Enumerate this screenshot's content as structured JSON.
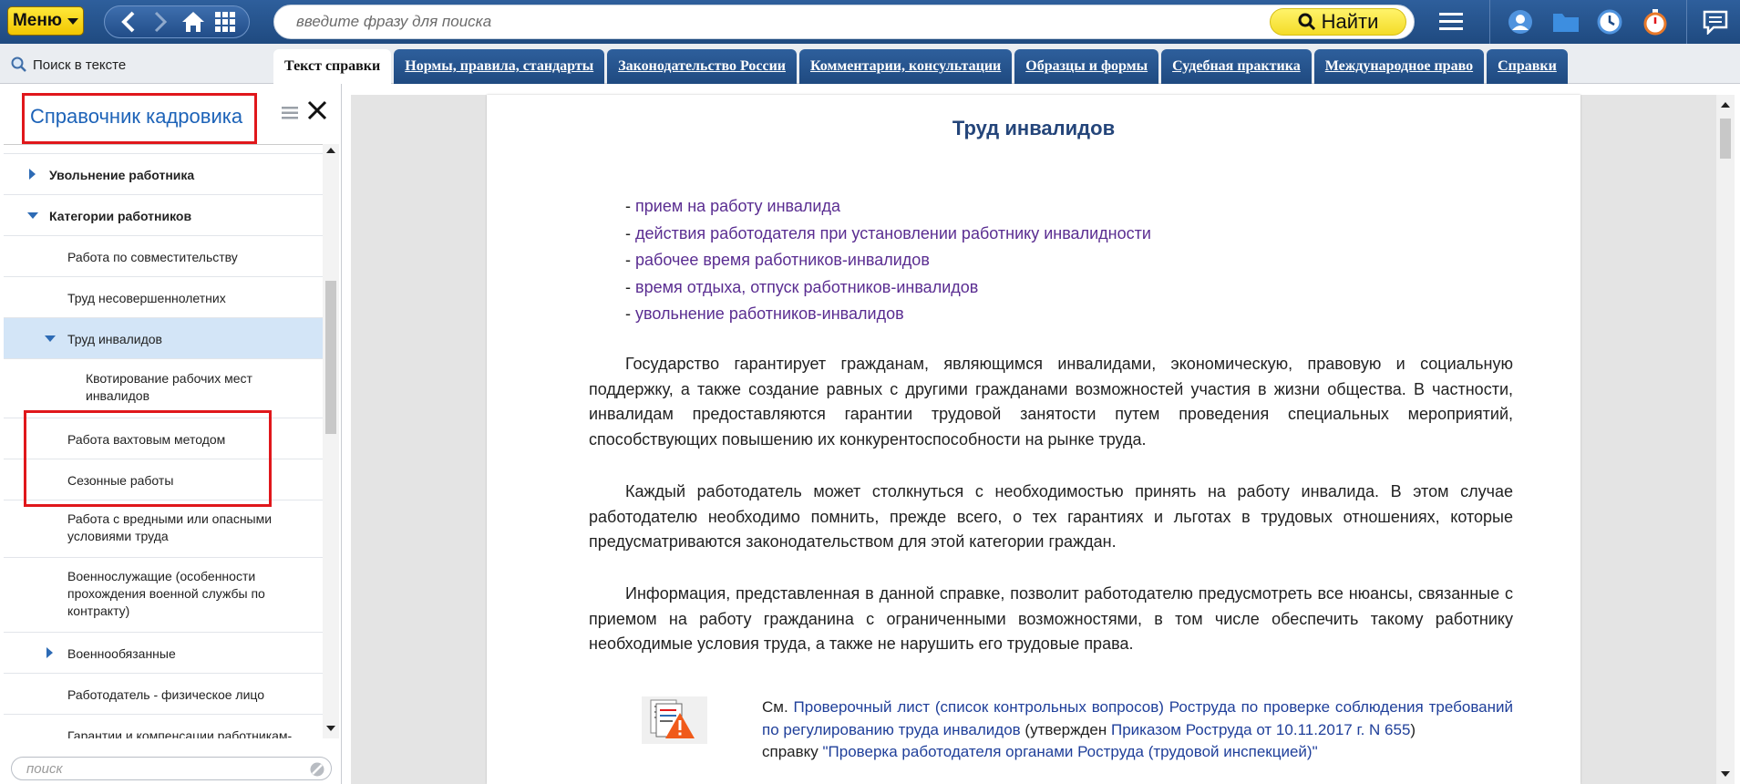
{
  "topbar": {
    "menu_label": "Меню",
    "search_placeholder": "введите фразу для поиска",
    "find_label": "Найти"
  },
  "tabsrow": {
    "search_in_text": "Поиск в тексте",
    "tabs": [
      {
        "label": "Текст справки",
        "active": true
      },
      {
        "label": "Нормы, правила, стандарты"
      },
      {
        "label": "Законодательство России"
      },
      {
        "label": "Комментарии, консультации"
      },
      {
        "label": "Образцы и формы"
      },
      {
        "label": "Судебная практика"
      },
      {
        "label": "Международное право"
      },
      {
        "label": "Справки"
      }
    ]
  },
  "sidebar": {
    "title": "Справочник кадровика",
    "search_placeholder": "поиск",
    "items": [
      {
        "label": "Увольнение работника"
      },
      {
        "label": "Категории работников"
      },
      {
        "label": "Работа по совместительству"
      },
      {
        "label": "Труд несовершеннолетних"
      },
      {
        "label": "Труд инвалидов"
      },
      {
        "label": "Квотирование рабочих мест инвалидов"
      },
      {
        "label": "Работа вахтовым методом"
      },
      {
        "label": "Сезонные работы"
      },
      {
        "label": "Работа с вредными или опасными условиями труда"
      },
      {
        "label": "Военнослужащие (особенности прохождения военной службы по контракту)"
      },
      {
        "label": "Военнообязанные"
      },
      {
        "label": "Работодатель - физическое лицо"
      },
      {
        "label": "Гарантии и компенсации работникам-"
      }
    ]
  },
  "document": {
    "title": "Труд инвалидов",
    "links": [
      "прием на работу инвалида",
      "действия работодателя при установлении работнику инвалидности",
      "рабочее время работников-инвалидов",
      "время отдыха, отпуск работников-инвалидов",
      "увольнение работников-инвалидов"
    ],
    "paragraphs": [
      "Государство гарантирует гражданам, являющимся инвалидами, экономическую, правовую и социальную поддержку, а также создание равных с другими гражданами возможностей участия в жизни общества. В частности, инвалидам предоставляются гарантии трудовой занятости путем проведения специальных мероприятий, способствующих повышению их конкурентоспособности на рынке труда.",
      "Каждый работодатель может столкнуться с необходимостью принять на работу инвалида. В этом случае работодателю необходимо помнить, прежде всего, о тех гарантиях и льготах в трудовых отношениях, которые предусматриваются законодательством для этой категории граждан.",
      "Информация, представленная в данной справке, позволит работодателю предусмотреть все нюансы, связанные с приемом на работу гражданина с ограниченными возможностями, в том числе обеспечить такому работнику необходимые условия труда, а также не нарушить его трудовые права."
    ],
    "see": {
      "prefix": "См.",
      "link1": "Проверочный лист (список контрольных вопросов) Роструда по проверке соблюдения требований по регулированию труда инвалидов",
      "mid": "(утвержден",
      "link2": "Приказом Роструда от 10.11.2017 г. N 655",
      "close": ")",
      "line2_prefix": "справку",
      "link3": "\"Проверка работодателя органами Роструда (трудовой инспекцией)\""
    }
  }
}
